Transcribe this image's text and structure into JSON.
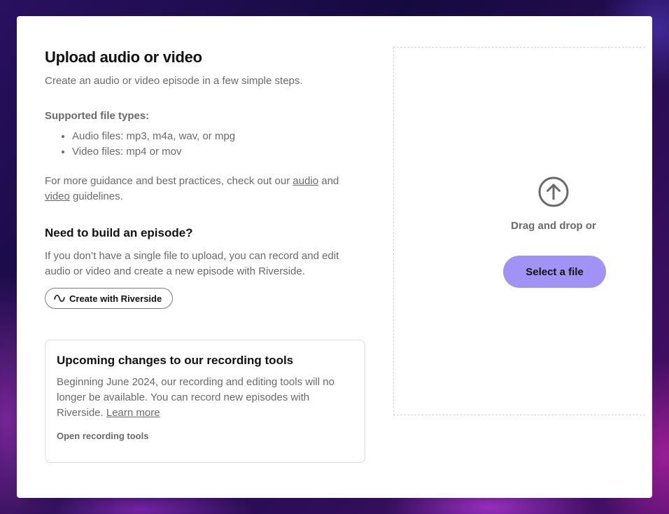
{
  "upload": {
    "title": "Upload audio or video",
    "intro": "Create an audio or video episode in a few simple steps.",
    "supported_title": "Supported file types:",
    "types": [
      "Audio files: mp3, m4a, wav, or mpg",
      "Video files: mp4 or mov"
    ],
    "guidance_prefix": "For more guidance and best practices, check out our",
    "guidance_audio_link": "audio",
    "guidance_and": "and",
    "guidance_video_link": "video",
    "guidance_suffix": "guidelines."
  },
  "build": {
    "title": "Need to build an episode?",
    "description": "If you don’t have a single file to upload, you can record and edit audio or video and create a new episode with Riverside.",
    "button_label": "Create with Riverside",
    "button_icon": "wave-icon"
  },
  "notice": {
    "title": "Upcoming changes to our recording tools",
    "description": "Beginning June 2024, our recording and editing tools will no longer be available. You can record new episodes with Riverside.",
    "learn_more": "Learn more",
    "open_tools": "Open recording tools"
  },
  "dropzone": {
    "icon": "upload-arrow-icon",
    "text": "Drag and drop or",
    "button_label": "Select a file",
    "accent_color": "#a093f5"
  }
}
